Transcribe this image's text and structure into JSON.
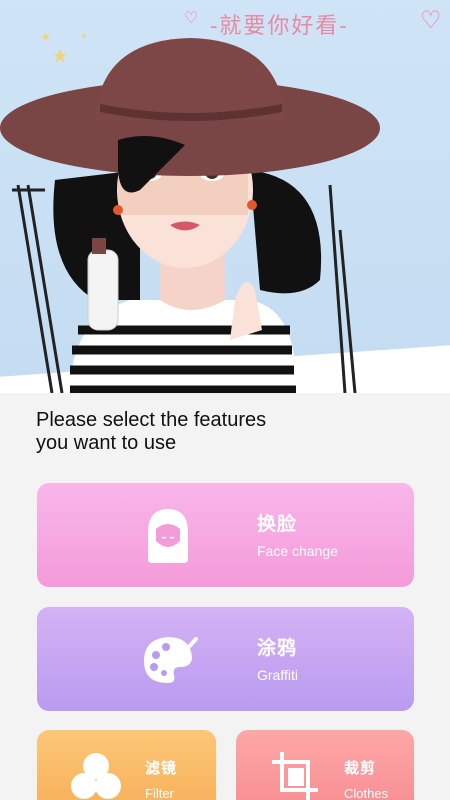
{
  "header": {
    "slogan": "-就要你好看-",
    "decor_icons": [
      "heart-icon",
      "star-icon"
    ]
  },
  "main": {
    "prompt_line1": "Please select the features",
    "prompt_line2": "you want to use",
    "features": [
      {
        "title": "换脸",
        "subtitle": "Face change",
        "icon": "face-icon",
        "color": "#f6a9e2"
      },
      {
        "title": "涂鸦",
        "subtitle": "Graffiti",
        "icon": "palette-icon",
        "color": "#c6a6f2"
      },
      {
        "title": "滤镜",
        "subtitle": "Filter",
        "icon": "filter-icon",
        "color": "#f9bb65"
      },
      {
        "title": "裁剪",
        "subtitle": "Clothes",
        "icon": "crop-icon",
        "color": "#fa9a9c"
      }
    ]
  }
}
